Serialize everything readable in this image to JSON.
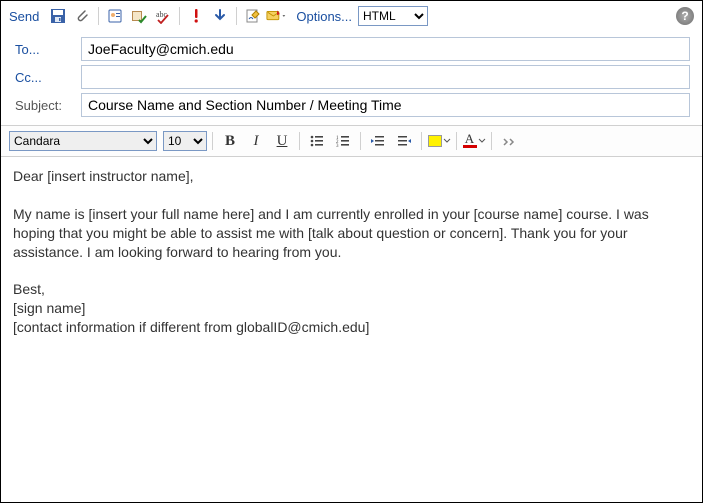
{
  "toolbar": {
    "send_label": "Send",
    "options_label": "Options...",
    "format_value": "HTML"
  },
  "fields": {
    "to_label": "To...",
    "to_value": "JoeFaculty@cmich.edu",
    "cc_label": "Cc...",
    "cc_value": "",
    "subject_label": "Subject:",
    "subject_value": "Course Name and Section Number / Meeting Time"
  },
  "editor": {
    "font_name": "Candara",
    "font_size": "10"
  },
  "body": "Dear [insert instructor name],\n\nMy name is [insert your full name here] and I am currently enrolled in your [course name] course. I was hoping that you might be able to assist me with [talk about question or concern]. Thank you for your assistance. I am looking forward to hearing from you.\n\nBest,\n[sign name]\n[contact information if different from globalID@cmich.edu]",
  "help_glyph": "?"
}
